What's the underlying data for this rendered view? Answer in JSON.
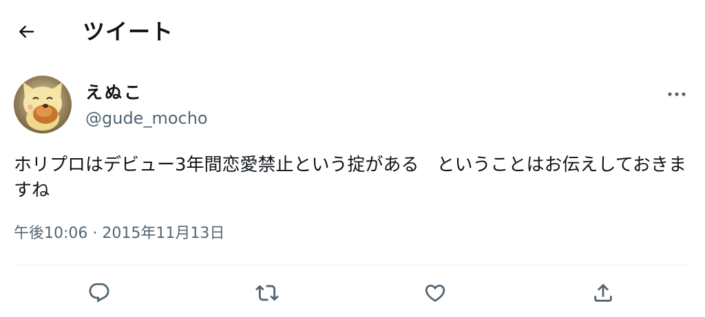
{
  "header": {
    "title": "ツイート",
    "back_icon": "arrow-left-icon"
  },
  "author": {
    "display_name": "えぬこ",
    "handle": "@gude_mocho",
    "avatar_icon": "cat-mascot-avatar"
  },
  "tweet": {
    "text": "ホリプロはデビュー3年間恋愛禁止という掟がある　ということはお伝えしておきますね",
    "timestamp": "午後10:06 · 2015年11月13日"
  },
  "actions": [
    {
      "name": "reply",
      "icon": "reply-icon"
    },
    {
      "name": "retweet",
      "icon": "retweet-icon"
    },
    {
      "name": "like",
      "icon": "heart-icon"
    },
    {
      "name": "share",
      "icon": "share-icon"
    }
  ],
  "colors": {
    "text_primary": "#0f1419",
    "text_secondary": "#536471",
    "divider": "#eff3f4"
  }
}
